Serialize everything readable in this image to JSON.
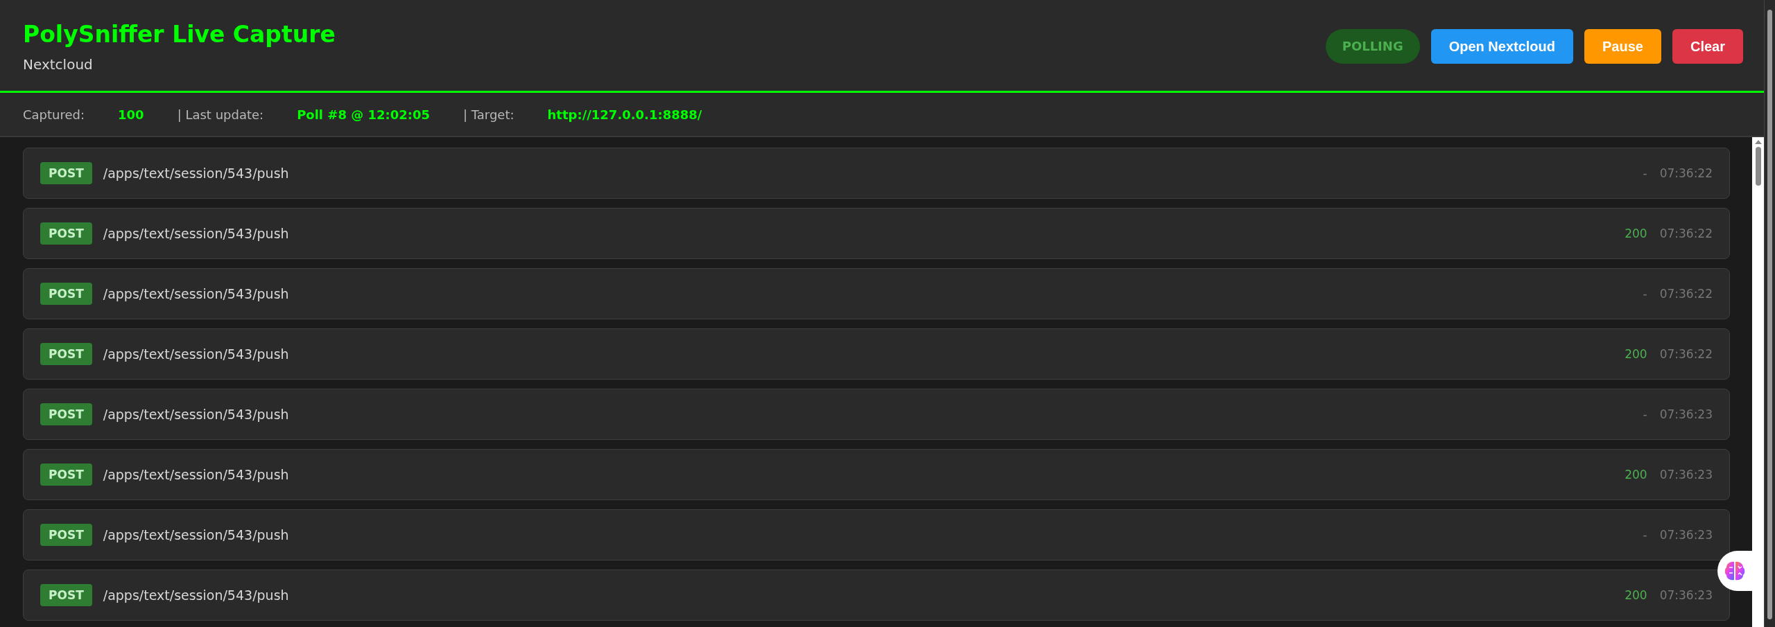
{
  "header": {
    "title": "PolySniffer Live Capture",
    "subtitle": "Nextcloud",
    "status_badge": "POLLING",
    "buttons": [
      {
        "label": "Open Nextcloud",
        "kind": "primary"
      },
      {
        "label": "Pause",
        "kind": "warning"
      },
      {
        "label": "Clear",
        "kind": "danger"
      }
    ]
  },
  "info_bar": [
    {
      "label": "Captured:",
      "value": "100"
    },
    {
      "label": "| Last update:",
      "value": "Poll #8 @ 12:02:05"
    },
    {
      "label": "| Target:",
      "value": "http://127.0.0.1:8888/"
    }
  ],
  "requests": [
    {
      "method": "POST",
      "path": "/apps/text/session/543/push",
      "status": "-",
      "ok": false,
      "time": "07:36:22"
    },
    {
      "method": "POST",
      "path": "/apps/text/session/543/push",
      "status": "200",
      "ok": true,
      "time": "07:36:22"
    },
    {
      "method": "POST",
      "path": "/apps/text/session/543/push",
      "status": "-",
      "ok": false,
      "time": "07:36:22"
    },
    {
      "method": "POST",
      "path": "/apps/text/session/543/push",
      "status": "200",
      "ok": true,
      "time": "07:36:22"
    },
    {
      "method": "POST",
      "path": "/apps/text/session/543/push",
      "status": "-",
      "ok": false,
      "time": "07:36:23"
    },
    {
      "method": "POST",
      "path": "/apps/text/session/543/push",
      "status": "200",
      "ok": true,
      "time": "07:36:23"
    },
    {
      "method": "POST",
      "path": "/apps/text/session/543/push",
      "status": "-",
      "ok": false,
      "time": "07:36:23"
    },
    {
      "method": "POST",
      "path": "/apps/text/session/543/push",
      "status": "200",
      "ok": true,
      "time": "07:36:23"
    }
  ]
}
